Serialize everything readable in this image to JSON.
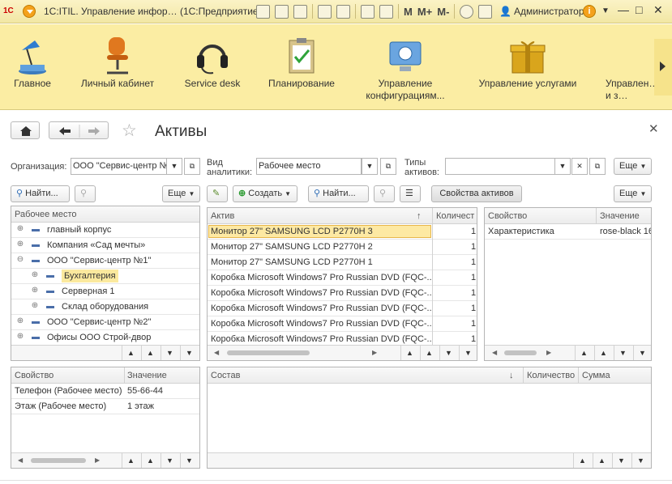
{
  "titlebar": {
    "logo": "1С",
    "title": "1C:ITIL. Управление инфор… (1С:Предприятие)",
    "m1": "M",
    "m2": "M+",
    "m3": "M-",
    "user": "Администратор"
  },
  "sections": [
    {
      "label": "Главное",
      "icon": "desk-lamp-icon"
    },
    {
      "label": "Личный кабинет",
      "icon": "office-chair-icon"
    },
    {
      "label": "Service desk",
      "icon": "headset-icon"
    },
    {
      "label": "Планирование",
      "icon": "clipboard-icon"
    },
    {
      "label": "Управление конфигурациям...",
      "icon": "network-icon"
    },
    {
      "label": "Управление услугами",
      "icon": "gift-box-icon"
    },
    {
      "label": "Управлен… и з…",
      "icon": ""
    }
  ],
  "form": {
    "title": "Активы",
    "org_label": "Организация:",
    "org_value": "ООО \"Сервис-центр №",
    "analytics_label": "Вид аналитики:",
    "analytics_value": "Рабочее место",
    "types_label": "Типы активов:",
    "types_value": "",
    "more": "Еще",
    "find": "Найти...",
    "create": "Создать",
    "asset_props": "Свойства активов"
  },
  "tree": {
    "header": "Рабочее место",
    "items": [
      {
        "label": "главный корпус",
        "level": 0,
        "toggle": "⊕"
      },
      {
        "label": "Компания «Сад мечты»",
        "level": 0,
        "toggle": "⊕"
      },
      {
        "label": "ООО \"Сервис-центр №1\"",
        "level": 0,
        "toggle": "⊖"
      },
      {
        "label": "Бухгалтерия",
        "level": 1,
        "toggle": "⊕",
        "highlight": true
      },
      {
        "label": "Серверная 1",
        "level": 1,
        "toggle": "⊕"
      },
      {
        "label": "Склад оборудования",
        "level": 1,
        "toggle": "⊕"
      },
      {
        "label": "ООО \"Сервис-центр №2\"",
        "level": 0,
        "toggle": "⊕"
      },
      {
        "label": "Офисы ООО Строй-двор",
        "level": 0,
        "toggle": "⊕"
      }
    ]
  },
  "assets": {
    "col_asset": "Актив",
    "col_qty": "Количест",
    "rows": [
      {
        "name": "Монитор 27\" SAMSUNG LCD P2770H 3",
        "qty": "1"
      },
      {
        "name": "Монитор 27\" SAMSUNG LCD P2770H 2",
        "qty": "1"
      },
      {
        "name": "Монитор 27\" SAMSUNG LCD P2770H 1",
        "qty": "1"
      },
      {
        "name": "Коробка Microsoft Windows7 Pro Russian DVD (FQC-...",
        "qty": "1"
      },
      {
        "name": "Коробка Microsoft Windows7 Pro Russian DVD (FQC-...",
        "qty": "1"
      },
      {
        "name": "Коробка Microsoft Windows7 Pro Russian DVD (FQC-...",
        "qty": "1"
      },
      {
        "name": "Коробка Microsoft Windows7 Pro Russian DVD (FQC-...",
        "qty": "1"
      },
      {
        "name": "Коробка Microsoft Windows7 Pro Russian DVD (FQC-...",
        "qty": "1"
      }
    ]
  },
  "props_right": {
    "col_prop": "Свойство",
    "col_val": "Значение",
    "rows": [
      {
        "prop": "Характеристика",
        "val": "rose-black 16"
      }
    ]
  },
  "props_left": {
    "col_prop": "Свойство",
    "col_val": "Значение",
    "rows": [
      {
        "prop": "Телефон (Рабочее место)",
        "val": "55-66-44"
      },
      {
        "prop": "Этаж (Рабочее место)",
        "val": "1 этаж"
      }
    ]
  },
  "composition": {
    "col_name": "Состав",
    "col_qty": "Количество",
    "col_sum": "Сумма"
  }
}
